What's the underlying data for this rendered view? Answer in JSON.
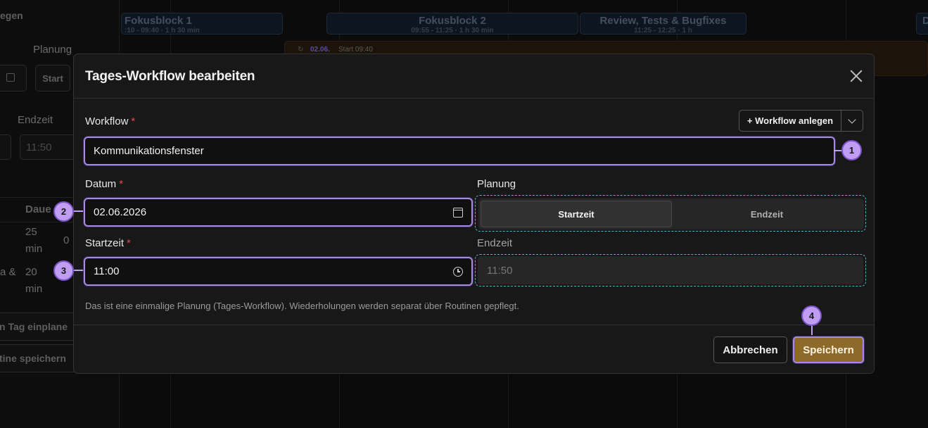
{
  "background": {
    "sidebar": {
      "heading_fragment": "egen",
      "planning_label": "Planung",
      "start_button": "Start",
      "end_label": "Endzeit",
      "end_value": "11:50",
      "table_header": "Daue",
      "row1_duration": "25",
      "row1_unit": "min",
      "row1_extra": "0",
      "row2_label": "a &",
      "row2_duration": "20",
      "row2_unit": "min",
      "plan_day_button": "n Tag einplane",
      "save_routine_button": "tine speichern"
    },
    "timeline": {
      "blocks": [
        {
          "title": "Fokusblock 1",
          "subtitle": ":10 - 09:40 · 1 h 30 min"
        },
        {
          "title": "Fokusblock 2",
          "subtitle": "09:55 - 11:25 · 1 h 30 min"
        },
        {
          "title": "Review, Tests & Bugfixes",
          "subtitle": "11:25 - 12:25 · 1 h"
        },
        {
          "title": "D",
          "subtitle": ""
        }
      ],
      "event_date": "02.06.",
      "event_start": "Start 09:40"
    }
  },
  "modal": {
    "title": "Tages-Workflow bearbeiten",
    "close_label": "×",
    "workflow": {
      "label": "Workflow",
      "required_mark": "*",
      "add_button": "+ Workflow anlegen",
      "value": "Kommunikationsfenster"
    },
    "date": {
      "label": "Datum",
      "required_mark": "*",
      "value": "02.06.2026"
    },
    "planning": {
      "label": "Planung",
      "options": [
        "Startzeit",
        "Endzeit"
      ],
      "selected": "Startzeit"
    },
    "start_time": {
      "label": "Startzeit",
      "required_mark": "*",
      "value": "11:00"
    },
    "end_time": {
      "label": "Endzeit",
      "value": "11:50"
    },
    "hint": "Das ist eine einmalige Planung (Tages-Workflow). Wiederholungen werden separat über Routinen gepflegt.",
    "buttons": {
      "cancel": "Abbrechen",
      "save": "Speichern"
    }
  },
  "annotations": [
    "1",
    "2",
    "3",
    "4"
  ],
  "colors": {
    "accent_purple": "#a58ae0",
    "save_button": "#8d6a2a",
    "required_red": "#e5484d",
    "dashed_cyan": "#4fb4c9"
  }
}
